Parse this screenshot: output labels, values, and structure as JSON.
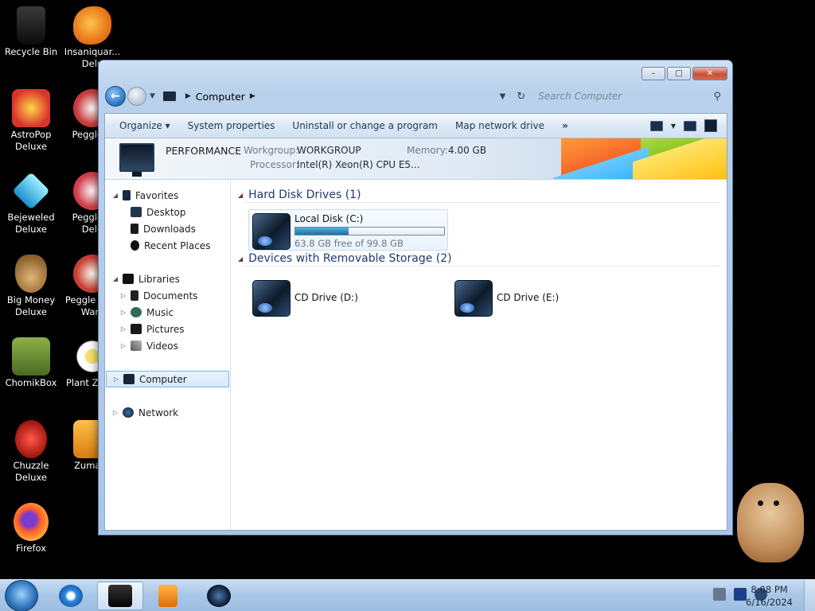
{
  "desktop": {
    "icons": [
      {
        "label": "Recycle Bin",
        "icon": "recycle-bin-icon",
        "color": "#1b1b1b"
      },
      {
        "label": "Insaniquar... Delu",
        "icon": "goldfish-icon",
        "color": "#f08a1c"
      },
      {
        "label": "AstroPop Deluxe",
        "icon": "astropop-icon",
        "color": "#d9342b"
      },
      {
        "label": "Peggle D",
        "icon": "peggle-icon",
        "color": "#c93a3a"
      },
      {
        "label": "Bejeweled Deluxe",
        "icon": "diamond-icon",
        "color": "#31b6e8"
      },
      {
        "label": "Peggle N Delu",
        "icon": "peggle-nights-icon",
        "color": "#d23d4a"
      },
      {
        "label": "Big Money Deluxe",
        "icon": "money-bag-icon",
        "color": "#b88a4a"
      },
      {
        "label": "Peggle W of Warc",
        "icon": "peggle-wow-icon",
        "color": "#c83e36"
      },
      {
        "label": "ChomikBox",
        "icon": "chomikbox-icon",
        "color": "#6d8d3e"
      },
      {
        "label": "Plant Zomb",
        "icon": "plants-vs-zombies-icon",
        "color": "#ffffff"
      },
      {
        "label": "Chuzzle Deluxe",
        "icon": "chuzzle-icon",
        "color": "#d8322a"
      },
      {
        "label": "Zuma D",
        "icon": "zuma-icon",
        "color": "#e89a1e"
      },
      {
        "label": "Firefox",
        "icon": "firefox-icon",
        "color": "#ff7139"
      }
    ]
  },
  "window": {
    "address": {
      "location": "Computer"
    },
    "search": {
      "placeholder": "Search Computer"
    },
    "caption": {
      "minimize": "–",
      "maximize": "□",
      "close": "✕"
    },
    "commands": {
      "organize": "Organize ▾",
      "system_properties": "System properties",
      "uninstall": "Uninstall or change a program",
      "map_drive": "Map network drive",
      "more": "»"
    },
    "details": {
      "name": "PERFORMANCE",
      "workgroup_label": "Workgroup:",
      "workgroup_value": "WORKGROUP",
      "memory_label": "Memory:",
      "memory_value": "4.00 GB",
      "processor_label": "Processor:",
      "processor_value": "Intel(R) Xeon(R) CPU E5..."
    },
    "nav": {
      "favorites": "Favorites",
      "desktop": "Desktop",
      "downloads": "Downloads",
      "recent_places": "Recent Places",
      "libraries": "Libraries",
      "documents": "Documents",
      "music": "Music",
      "pictures": "Pictures",
      "videos": "Videos",
      "computer": "Computer",
      "network": "Network"
    },
    "main": {
      "hdd_group": "Hard Disk Drives (1)",
      "removable_group": "Devices with Removable Storage (2)",
      "local_disk": {
        "name": "Local Disk (C:)",
        "free_text": "63.8 GB free of 99.8 GB",
        "used_fraction": 0.36
      },
      "cd_d": "CD Drive (D:)",
      "cd_e": "CD Drive (E:)"
    }
  },
  "taskbar": {
    "time": "8:08 PM",
    "date": "6/16/2024"
  },
  "colors": {
    "accent": "#2a6fc2",
    "selection": "#d6e8fb",
    "drive_bar": "#1c6fa3"
  }
}
